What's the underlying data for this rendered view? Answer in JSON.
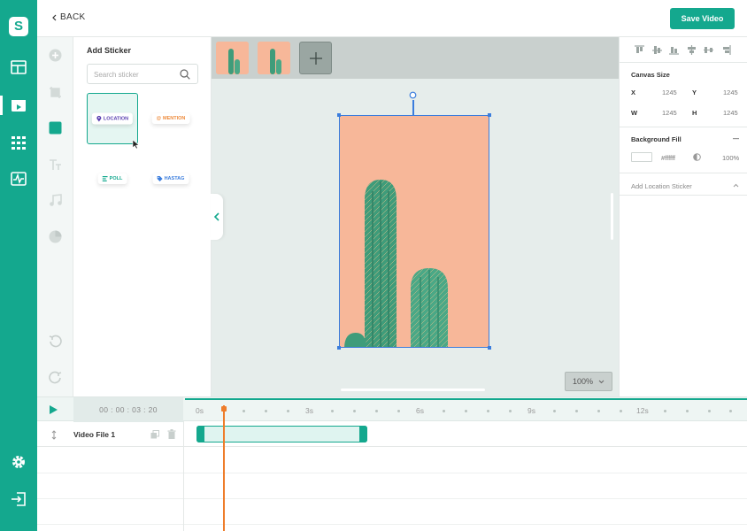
{
  "header": {
    "back_label": "BACK",
    "save_label": "Save Video"
  },
  "app": {
    "logo_letter": "S"
  },
  "rail_icons": [
    "layout-icon",
    "video-editor-icon",
    "grid-icon",
    "activity-icon",
    "settings-icon",
    "logout-icon"
  ],
  "tool_icons": [
    "add-icon",
    "crop-icon",
    "shape-icon",
    "text-icon",
    "music-icon",
    "pie-icon",
    "undo-icon",
    "redo-icon"
  ],
  "sticker_panel": {
    "title": "Add Sticker",
    "search_placeholder": "Search sticker",
    "stickers": [
      {
        "label": "LOCATION",
        "icon": "location-pin-icon",
        "color": "#5a3fb0",
        "selected": true
      },
      {
        "label": "MENTION",
        "icon": "at-icon",
        "color": "#ee8b3c",
        "selected": false
      },
      {
        "label": "POLL",
        "icon": "poll-icon",
        "color": "#14a88e",
        "selected": false
      },
      {
        "label": "HASTAG",
        "icon": "tag-icon",
        "color": "#3b7ddd",
        "selected": false
      }
    ]
  },
  "stage": {
    "zoom_label": "100%"
  },
  "properties": {
    "canvas_size_title": "Canvas Size",
    "x_label": "X",
    "x_value": "1245",
    "y_label": "Y",
    "y_value": "1245",
    "w_label": "W",
    "w_value": "1245",
    "h_label": "H",
    "h_value": "1245",
    "background_fill_title": "Background Fill",
    "fill_hex": "#ffffff",
    "fill_opacity": "100%",
    "location_sticker_title": "Add Location Sticker"
  },
  "timeline": {
    "current_time": "00 : 00 : 03 : 20",
    "ruler_labels": [
      "0s",
      "3s",
      "6s",
      "9s",
      "12s"
    ],
    "track_name": "Video File 1"
  },
  "colors": {
    "accent": "#14a88e",
    "playhead": "#ee7d2b",
    "selection": "#3b7ddd"
  }
}
